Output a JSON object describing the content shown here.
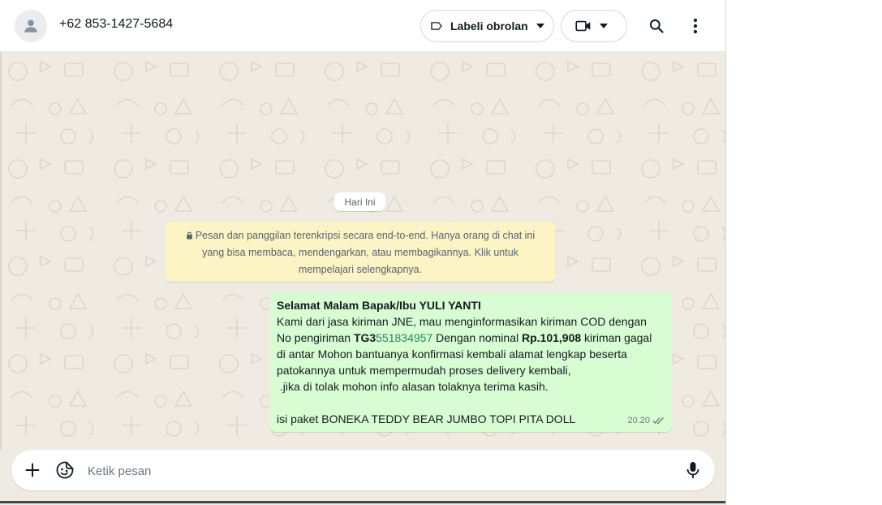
{
  "header": {
    "contact_name": "+62 853-1427-5684",
    "label_button": "Labeli obrolan",
    "icons": {
      "avatar": "person-icon",
      "label": "label-tag-icon",
      "video": "video-camera-icon",
      "search": "search-icon",
      "menu": "more-vertical-icon"
    }
  },
  "chat": {
    "date_chip": "Hari Ini",
    "encryption_notice": {
      "line1": "Pesan dan panggilan terenkripsi secara end-to-end. Hanya orang di chat ini",
      "line2": "yang bisa membaca, mendengarkan, atau membagikannya. Klik untuk",
      "line3": "mempelajari selengkapnya."
    },
    "message": {
      "greeting": "Selamat Malam Bapak/Ibu YULI YANTI",
      "line2": "Kami dari jasa kiriman JNE, mau menginformasikan kiriman COD dengan",
      "line3_a": "No pengiriman ",
      "tracking_prefix": "TG3",
      "tracking_number": "551834957",
      "line3_b": " Dengan nominal ",
      "amount": "Rp.101,908",
      "line3_c": " kiriman gagal",
      "line4": "di antar Mohon bantuanya konfirmasi kembali alamat lengkap beserta",
      "line5": "patokannya untuk mempermudah proses delivery kembali,",
      "line6": " .jika di tolak mohon info alasan tolaknya terima kasih.",
      "line7": "isi paket BONEKA TEDDY BEAR JUMBO TOPI PITA DOLL",
      "time": "20.20",
      "status_icon": "double-check-icon"
    }
  },
  "composer": {
    "placeholder": "Ketik pesan",
    "icons": {
      "attach": "plus-icon",
      "sticker": "sticker-icon",
      "mic": "microphone-icon"
    }
  },
  "colors": {
    "outgoing_bubble": "#d9fdd3",
    "notice_bg": "#fdf4c5",
    "chat_bg": "#efeae2",
    "tracking_green": "#1f8a5c"
  }
}
